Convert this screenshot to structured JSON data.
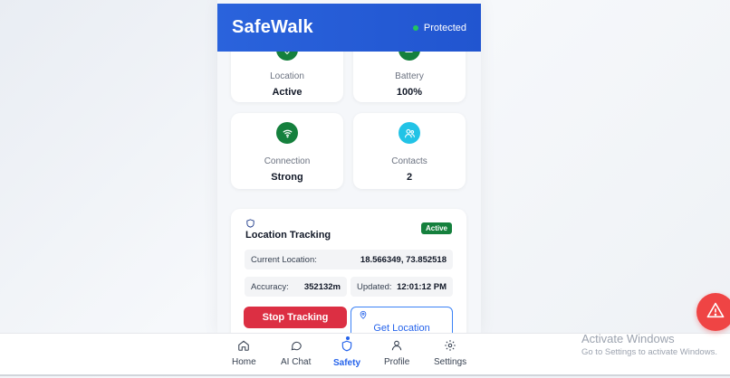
{
  "header": {
    "title": "SafeWalk",
    "status": "Protected"
  },
  "status_cards": [
    {
      "label": "Location",
      "value": "Active",
      "icon": "location-icon"
    },
    {
      "label": "Battery",
      "value": "100%",
      "icon": "battery-icon"
    },
    {
      "label": "Connection",
      "value": "Strong",
      "icon": "wifi-icon"
    },
    {
      "label": "Contacts",
      "value": "2",
      "icon": "users-icon"
    }
  ],
  "tracking": {
    "title": "Location Tracking",
    "badge": "Active",
    "current_location_label": "Current Location:",
    "current_location_value": "18.566349, 73.852518",
    "accuracy_label": "Accuracy:",
    "accuracy_value": "352132m",
    "updated_label": "Updated:",
    "updated_value": "12:01:12 PM",
    "stop_button": "Stop Tracking",
    "get_location_button": "Get Location"
  },
  "nav": [
    {
      "label": "Home",
      "icon": "home-icon",
      "active": false
    },
    {
      "label": "AI Chat",
      "icon": "chat-icon",
      "active": false
    },
    {
      "label": "Safety",
      "icon": "shield-icon",
      "active": true
    },
    {
      "label": "Profile",
      "icon": "user-icon",
      "active": false
    },
    {
      "label": "Settings",
      "icon": "gear-icon",
      "active": false
    }
  ],
  "watermark": {
    "line1": "Activate Windows",
    "line2": "Go to Settings to activate Windows."
  },
  "colors": {
    "header": "#2155d0",
    "accent": "#2563eb",
    "danger": "#dc2f43",
    "success": "#15803d",
    "connection_icon_bg": "#15803d",
    "contacts_icon_bg": "#22c3e6"
  }
}
